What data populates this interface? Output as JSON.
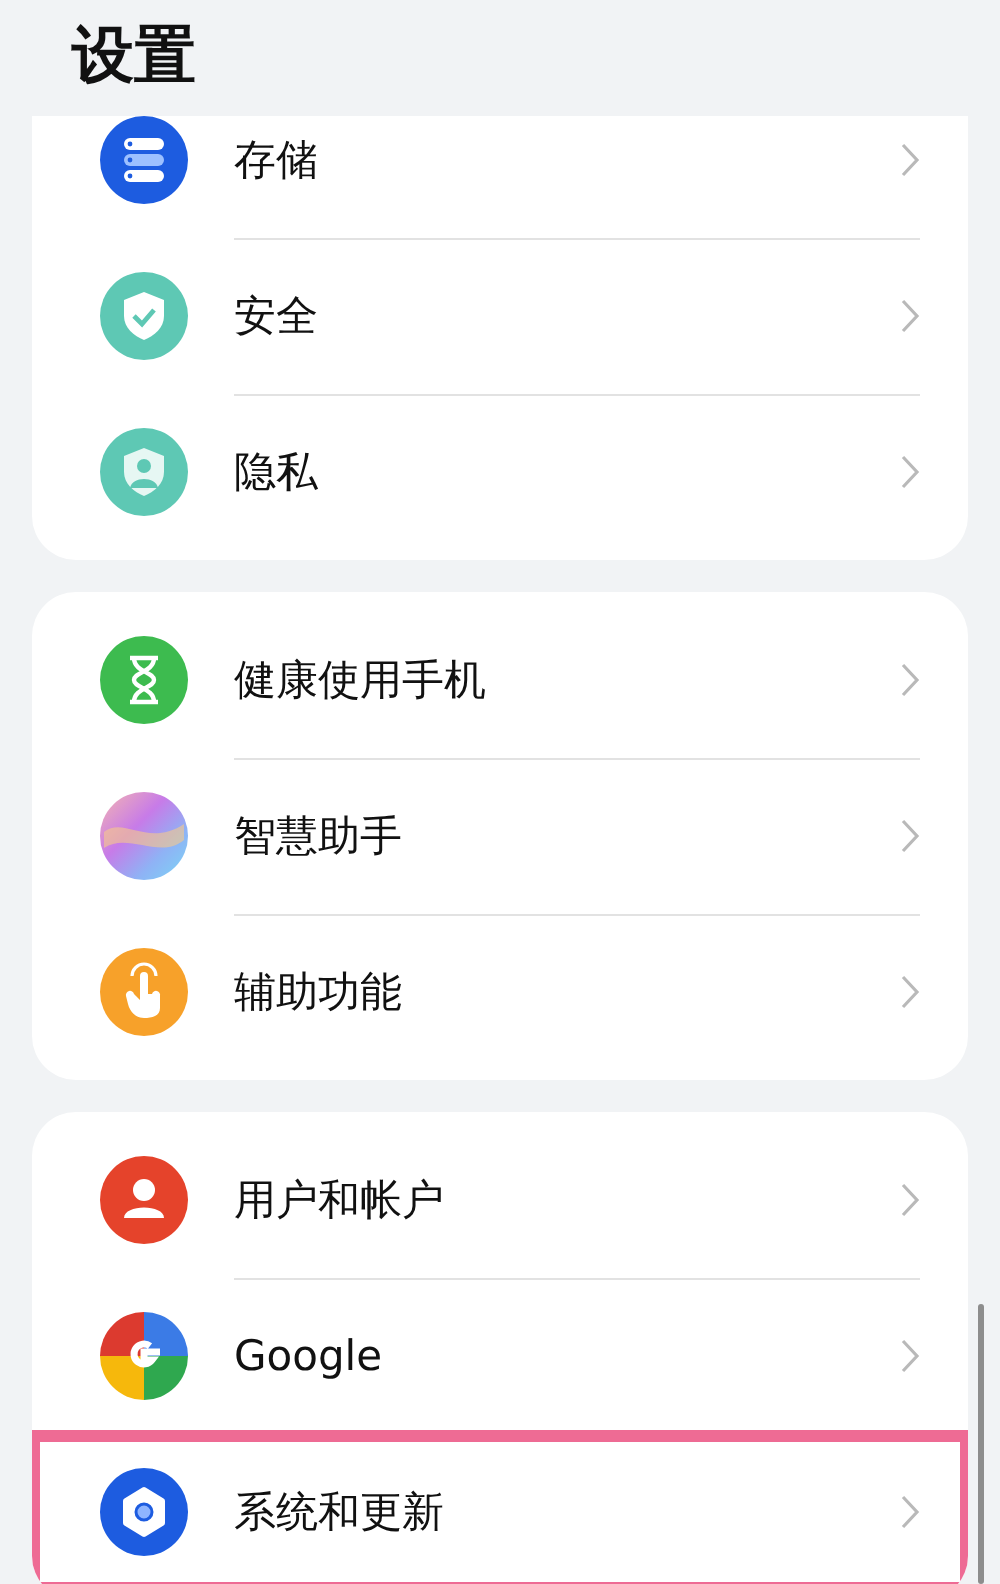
{
  "header": {
    "title": "设置"
  },
  "groups": [
    {
      "items": [
        {
          "label": "存储",
          "highlighted": false
        },
        {
          "label": "安全",
          "highlighted": false
        },
        {
          "label": "隐私",
          "highlighted": false
        }
      ]
    },
    {
      "items": [
        {
          "label": "健康使用手机",
          "highlighted": false
        },
        {
          "label": "智慧助手",
          "highlighted": false
        },
        {
          "label": "辅助功能",
          "highlighted": false
        }
      ]
    },
    {
      "items": [
        {
          "label": "用户和帐户",
          "highlighted": false
        },
        {
          "label": "Google",
          "highlighted": false
        },
        {
          "label": "系统和更新",
          "highlighted": true
        }
      ]
    }
  ]
}
